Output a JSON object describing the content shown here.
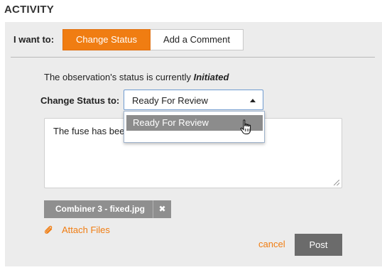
{
  "section": {
    "title": "ACTIVITY"
  },
  "activity": {
    "want_label": "I want to:",
    "tabs": [
      {
        "label": "Change Status",
        "active": true
      },
      {
        "label": "Add a Comment",
        "active": false
      }
    ],
    "status_prefix": "The observation's status is currently ",
    "current_status": "Initiated",
    "change_label": "Change Status to:",
    "selected_status": "Ready For Review",
    "dropdown_options": [
      "Ready For Review"
    ],
    "comment_text": "The fuse has bee",
    "attachment": {
      "file_name": "Combiner 3 - fixed.jpg",
      "remove_icon": "close-icon"
    },
    "attach_label": "Attach Files",
    "cancel_label": "cancel",
    "post_label": "Post"
  },
  "colors": {
    "accent": "#f07d12",
    "panel_bg": "#ececec",
    "chip_bg": "#8f8f8f",
    "post_bg": "#6b6b6b"
  }
}
